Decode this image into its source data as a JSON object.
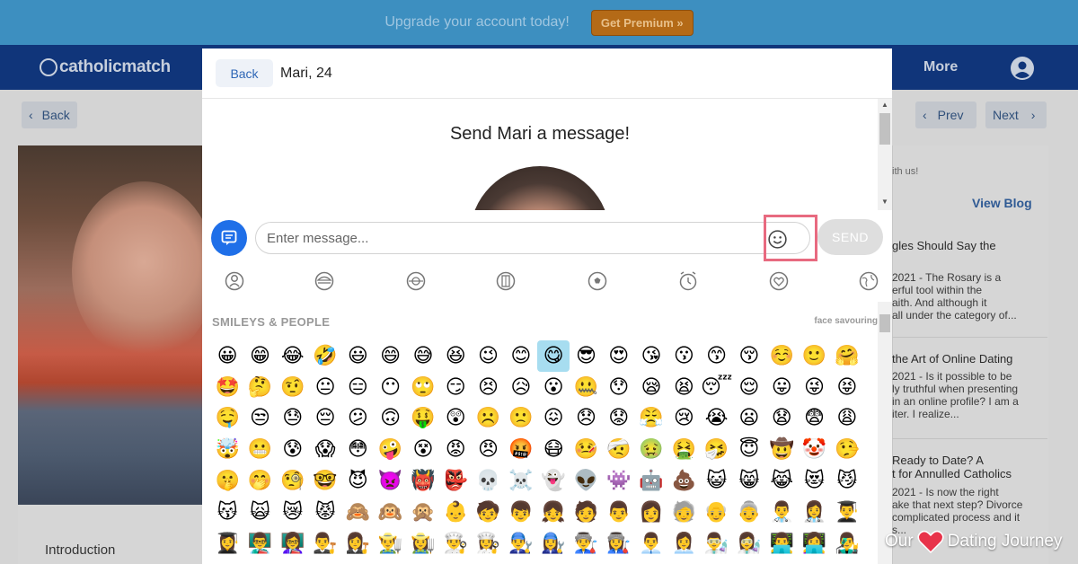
{
  "promo": {
    "text": "Upgrade your account today!",
    "button": "Get Premium »"
  },
  "nav": {
    "logo": "catholicmatch",
    "more": "More"
  },
  "page": {
    "back": "Back",
    "prev": "Prev",
    "next": "Next",
    "intro": "Introduction",
    "side_small": "ith us!",
    "view_blog": "View Blog",
    "blog": [
      {
        "title": "gles Should Say the",
        "body": "2021 - The Rosary is a\nerful tool within the\naith. And although it\nall under the category of..."
      },
      {
        "title": "the Art of Online Dating",
        "body": "2021 - Is it possible to be\nly truthful when presenting\nin an online profile? I am a\niter. I realize..."
      },
      {
        "title": "Ready to Date? A\nt for Annulled Catholics",
        "body": "2021 - Is now the right\nake that next step? Divorce\ncomplicated process and it\ns..."
      }
    ]
  },
  "modal": {
    "back": "Back",
    "name": "Mari, 24",
    "title": "Send Mari a message!",
    "input_placeholder": "Enter message...",
    "send": "SEND",
    "category": "SMILEYS & PEOPLE",
    "preview": "face savouring",
    "emoji_tabs": [
      "person-icon",
      "food-icon",
      "activity-icon",
      "building-icon",
      "ball-icon",
      "clock-icon",
      "heart-icon",
      "globe-icon"
    ],
    "emojis": [
      "😀",
      "😁",
      "😂",
      "🤣",
      "😃",
      "😄",
      "😅",
      "😆",
      "😉",
      "😊",
      "😋",
      "😎",
      "😍",
      "😘",
      "😗",
      "😙",
      "😚",
      "☺️",
      "🙂",
      "🤗",
      "🤩",
      "🤔",
      "🤨",
      "😐",
      "😑",
      "😶",
      "🙄",
      "😏",
      "😣",
      "😥",
      "😮",
      "🤐",
      "😯",
      "😪",
      "😫",
      "😴",
      "😌",
      "😛",
      "😜",
      "😝",
      "🤤",
      "😒",
      "😓",
      "😔",
      "😕",
      "🙃",
      "🤑",
      "😲",
      "☹️",
      "🙁",
      "😖",
      "😞",
      "😟",
      "😤",
      "😢",
      "😭",
      "😦",
      "😧",
      "😨",
      "😩",
      "🤯",
      "😬",
      "😰",
      "😱",
      "😳",
      "🤪",
      "😵",
      "😡",
      "😠",
      "🤬",
      "😷",
      "🤒",
      "🤕",
      "🤢",
      "🤮",
      "🤧",
      "😇",
      "🤠",
      "🤡",
      "🤥",
      "🤫",
      "🤭",
      "🧐",
      "🤓",
      "😈",
      "👿",
      "👹",
      "👺",
      "💀",
      "☠️",
      "👻",
      "👽",
      "👾",
      "🤖",
      "💩",
      "😺",
      "😸",
      "😹",
      "😻",
      "😼",
      "😽",
      "🙀",
      "😿",
      "😾",
      "🙈",
      "🙉",
      "🙊",
      "👶",
      "🧒",
      "👦",
      "👧",
      "🧑",
      "👨",
      "👩",
      "🧓",
      "👴",
      "👵",
      "👨‍⚕️",
      "👩‍⚕️",
      "👨‍🎓",
      "👩‍🎓",
      "👨‍🏫",
      "👩‍🏫",
      "👨‍⚖️",
      "👩‍⚖️",
      "👨‍🌾",
      "👩‍🌾",
      "👨‍🍳",
      "👩‍🍳",
      "👨‍🔧",
      "👩‍🔧",
      "👨‍🏭",
      "👩‍🏭",
      "👨‍💼",
      "👩‍💼",
      "👨‍🔬",
      "👩‍🔬",
      "👨‍💻",
      "👩‍💻",
      "👨‍🎤"
    ],
    "selected_index": 10
  },
  "watermark": {
    "left": "Our",
    "right": "Dating Journey"
  },
  "colors": {
    "accent": "#1f6fe8",
    "nav": "#10357a",
    "promo": "#3d8fc0",
    "highlight": "#e86a80"
  }
}
